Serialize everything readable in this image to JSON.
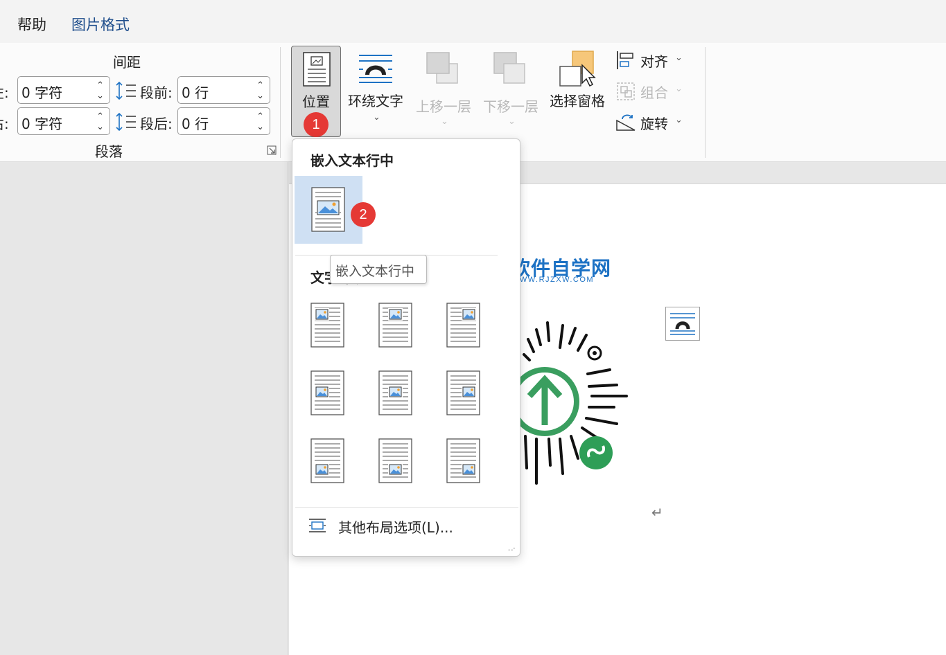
{
  "tabs": [
    {
      "label": "帮助",
      "active": false
    },
    {
      "label": "图片格式",
      "active": true
    }
  ],
  "paragraph_group": {
    "spacing_heading": "间距",
    "left_indent_label": "左:",
    "left_indent_value": "0 字符",
    "right_indent_label": "右:",
    "right_indent_value": "0 字符",
    "before_label": "段前:",
    "before_value": "0 行",
    "after_label": "段后:",
    "after_value": "0 行",
    "group_label": "段落"
  },
  "arrange_group": {
    "position_label": "位置",
    "wrap_text_label": "环绕文字",
    "bring_forward_label": "上移一层",
    "send_backward_label": "下移一层",
    "selection_pane_label": "选择窗格",
    "align_label": "对齐",
    "group_label": "组合",
    "rotate_label": "旋转"
  },
  "badges": {
    "step1": "1",
    "step2": "2"
  },
  "dropdown": {
    "inline_heading": "嵌入文本行中",
    "wrap_heading": "文字环绕",
    "tooltip": "嵌入文本行中",
    "more_options": "其他布局选项(L)..."
  },
  "document": {
    "watermark_title": "软件自学网",
    "watermark_url": "WWW.RJZXW.COM",
    "paragraph_mark": "↵"
  },
  "colors": {
    "accent_tab": "#1f4e8c",
    "badge": "#e53935",
    "selected_tile": "#cfe0f3",
    "watermark": "#1d72c4",
    "qr_green": "#3a9e5f"
  }
}
